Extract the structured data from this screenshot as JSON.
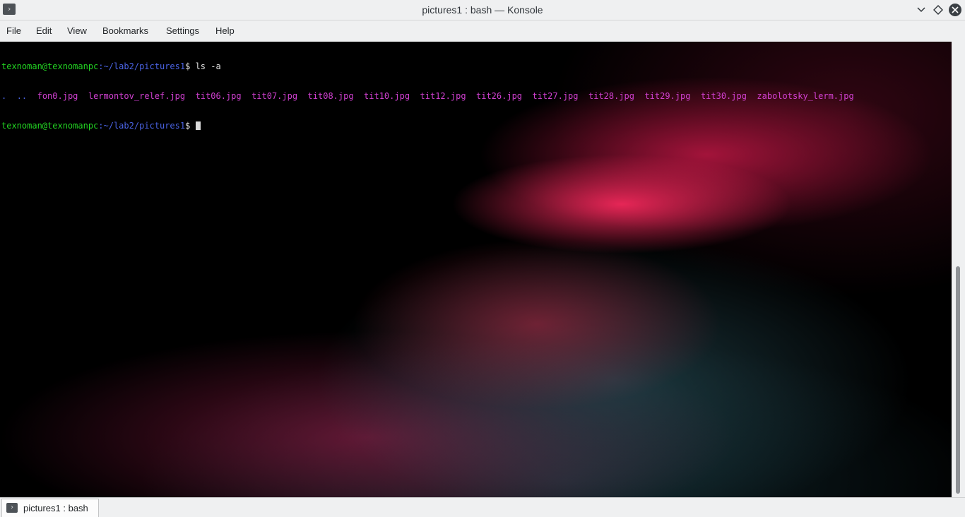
{
  "window": {
    "title": "pictures1 : bash — Konsole",
    "app_icon_glyph": "›"
  },
  "menu": {
    "items": [
      {
        "label": "File"
      },
      {
        "label": "Edit"
      },
      {
        "label": "View"
      },
      {
        "label": "Bookmarks"
      },
      {
        "label": "Settings"
      },
      {
        "label": "Help"
      }
    ]
  },
  "terminal": {
    "prompt_user": "texnoman@texnomanpc",
    "prompt_path": ":~/lab2/pictures1",
    "prompt_symbol": "$ ",
    "command": "ls -a",
    "listing": {
      "dirs": [
        ".",
        ".."
      ],
      "files": [
        "fon0.jpg",
        "lermontov_relef.jpg",
        "tit06.jpg",
        "tit07.jpg",
        "tit08.jpg",
        "tit10.jpg",
        "tit12.jpg",
        "tit26.jpg",
        "tit27.jpg",
        "tit28.jpg",
        "tit29.jpg",
        "tit30.jpg",
        "zabolotsky_lerm.jpg"
      ]
    }
  },
  "tabs": [
    {
      "label": "pictures1 : bash",
      "icon": "terminal-icon"
    }
  ],
  "colors": {
    "prompt_user": "#22d422",
    "prompt_path": "#4b64e6",
    "image_files": "#d040d0",
    "chrome": "#eff0f1"
  }
}
